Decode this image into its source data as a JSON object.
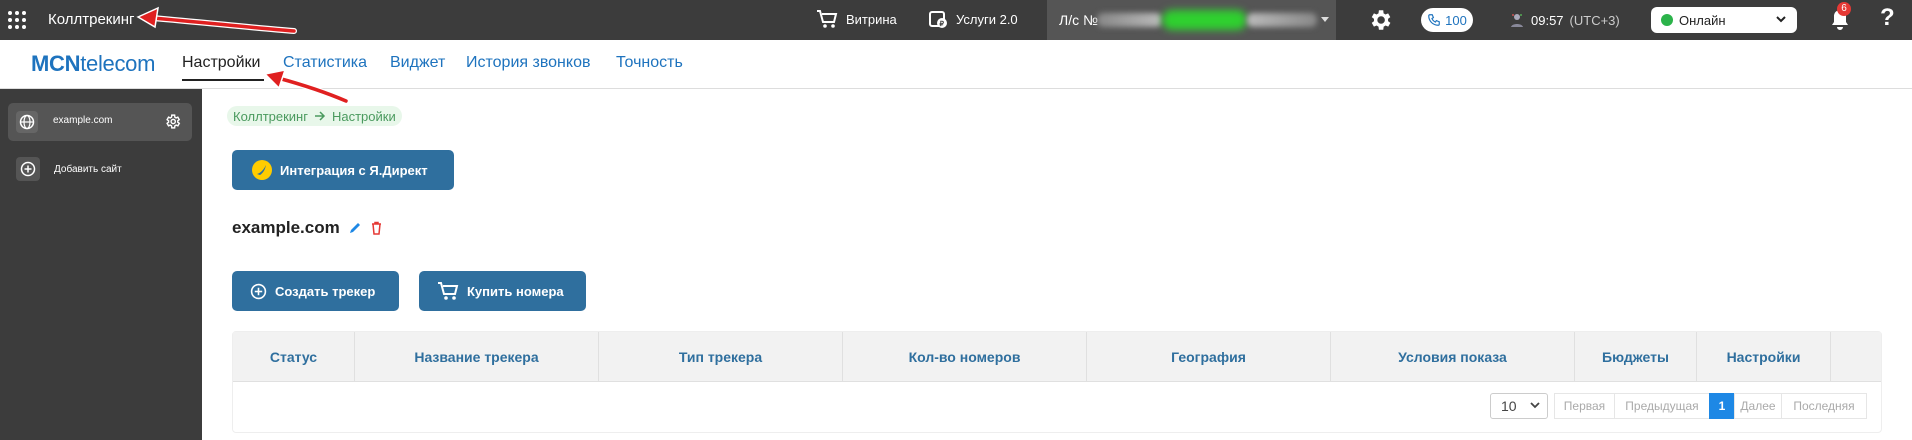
{
  "topbar": {
    "app_title": "Коллтрекинг",
    "vitrina_label": "Витрина",
    "services_label": "Услуги 2.0",
    "account_label": "Л/с №",
    "phone_count": "100",
    "time": "09:57",
    "timezone": "(UTC+3)",
    "status_value": "Онлайн",
    "notifications_count": "6",
    "help_label": "?"
  },
  "navbar": {
    "logo_bold": "MCN",
    "logo_rest": "telecom",
    "items": [
      "Настройки",
      "Статистика",
      "Виджет",
      "История звонков",
      "Точность"
    ],
    "active_item": "Настройки"
  },
  "sidebar": {
    "site_name": "example.com",
    "add_site_label": "Добавить сайт"
  },
  "breadcrumb": {
    "items": [
      "Коллтрекинг",
      "Настройки"
    ]
  },
  "main": {
    "integration_button": "Интеграция с Я.Директ",
    "site_title": "example.com",
    "create_tracker_button": "Создать трекер",
    "buy_numbers_button": "Купить номера"
  },
  "table": {
    "columns": [
      "Статус",
      "Название трекера",
      "Тип трекера",
      "Кол-во номеров",
      "География",
      "Условия показа",
      "Бюджеты",
      "Настройки"
    ]
  },
  "pagination": {
    "per_page": "10",
    "first": "Первая",
    "prev": "Предыдущая",
    "current": "1",
    "next": "Далее",
    "last": "Последняя"
  },
  "colors": {
    "topbar_bg": "#3c3c3c",
    "accent_blue": "#2f6f9e",
    "link_blue": "#1e73be",
    "online_green": "#2bb34a",
    "annotation_red": "#e02020"
  },
  "icons": [
    "apps-grid-icon",
    "cart-icon",
    "services-icon",
    "gear-icon",
    "phone-icon",
    "user-icon",
    "chevron-down-icon",
    "bell-icon",
    "globe-icon",
    "plus-circle-icon",
    "yandex-direct-icon",
    "pencil-icon",
    "trash-icon"
  ]
}
